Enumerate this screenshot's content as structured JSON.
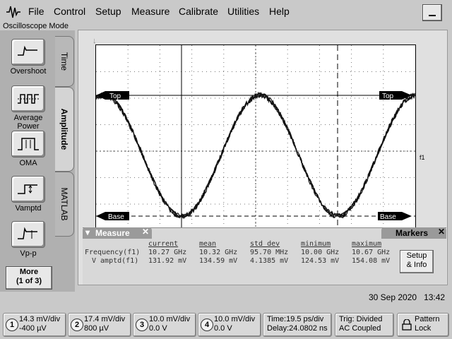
{
  "menu": {
    "file": "File",
    "control": "Control",
    "setup": "Setup",
    "measure": "Measure",
    "calibrate": "Calibrate",
    "utilities": "Utilities",
    "help": "Help"
  },
  "mode": "Oscilloscope Mode",
  "tools": [
    {
      "label": "Overshoot",
      "icon": "overshoot-icon"
    },
    {
      "label": "Average\nPower",
      "icon": "average-power-icon"
    },
    {
      "label": "OMA",
      "icon": "oma-icon"
    },
    {
      "label": "Vamptd",
      "icon": "vamptd-icon"
    },
    {
      "label": "Vp-p",
      "icon": "vpp-icon"
    }
  ],
  "more": {
    "line1": "More",
    "line2": "(1 of 3)"
  },
  "tabs": {
    "time": "Time",
    "amplitude": "Amplitude",
    "matlab": "MATLAB"
  },
  "display": {
    "top_label": "Top",
    "base_label": "Base",
    "marker": "f1"
  },
  "measurements": {
    "title": "Measure",
    "markers": "Markers",
    "headers": [
      "current",
      "mean",
      "std dev",
      "minimum",
      "maximum"
    ],
    "rows": [
      {
        "name": "Frequency(f1)",
        "values": [
          "10.27 GHz",
          "10.32 GHz",
          "95.70 MHz",
          "10.00 GHz",
          "10.67 GHz"
        ]
      },
      {
        "name": "V amptd(f1)",
        "values": [
          "131.92 mV",
          "134.59 mV",
          "4.1385 mV",
          "124.53 mV",
          "154.08 mV"
        ]
      }
    ],
    "setup_info": "Setup\n& Info"
  },
  "datetime": {
    "date": "30 Sep 2020",
    "time": "13:42"
  },
  "channels": [
    {
      "num": "1",
      "line1": "14.3 mV/div",
      "line2": "-400 µV"
    },
    {
      "num": "2",
      "line1": "17.4 mV/div",
      "line2": "800 µV"
    },
    {
      "num": "3",
      "line1": "10.0 mV/div",
      "line2": "0.0 V"
    },
    {
      "num": "4",
      "line1": "10.0 mV/div",
      "line2": "0.0 V"
    }
  ],
  "timebase": {
    "line1": "Time:19.5 ps/div",
    "line2": "Delay:24.0802 ns"
  },
  "trigger": {
    "line1": "Trig: Divided",
    "line2": "AC Coupled"
  },
  "pattern": {
    "line1": "Pattern",
    "line2": "Lock"
  }
}
